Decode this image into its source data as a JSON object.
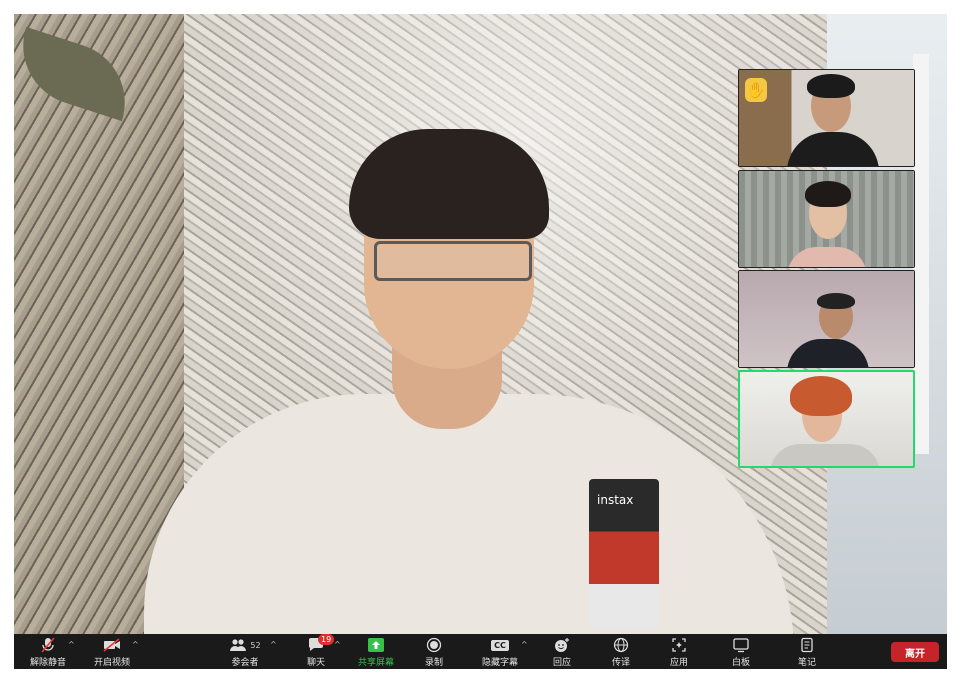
{
  "toolbar": {
    "unmute": "解除静音",
    "start_video": "开启视频",
    "participants": "参会者",
    "participants_count": "52",
    "chat": "聊天",
    "chat_badge": "19",
    "share_screen": "共享屏幕",
    "record": "录制",
    "captions": "隐藏字幕",
    "captions_icon_text": "CC",
    "reactions": "回应",
    "translate": "传译",
    "apps": "应用",
    "whiteboard": "白板",
    "notes": "笔记",
    "leave": "离开"
  },
  "main_video": {
    "shirt_print": "instax"
  },
  "thumbnails": [
    {
      "raised_hand": "✋",
      "active": false
    },
    {
      "raised_hand": "",
      "active": false
    },
    {
      "raised_hand": "",
      "active": false
    },
    {
      "raised_hand": "",
      "active": true
    }
  ],
  "colors": {
    "toolbar_bg": "#1a1a1a",
    "share_green": "#36c24a",
    "leave_red": "#c6242a",
    "badge_red": "#e02d2d",
    "active_speaker_border": "#23d96e"
  },
  "icons": [
    "mic-muted-icon",
    "video-off-icon",
    "participants-icon",
    "chat-icon",
    "share-screen-icon",
    "record-icon",
    "captions-icon",
    "reactions-icon",
    "translate-icon",
    "apps-icon",
    "whiteboard-icon",
    "notes-icon",
    "raised-hand-icon"
  ]
}
